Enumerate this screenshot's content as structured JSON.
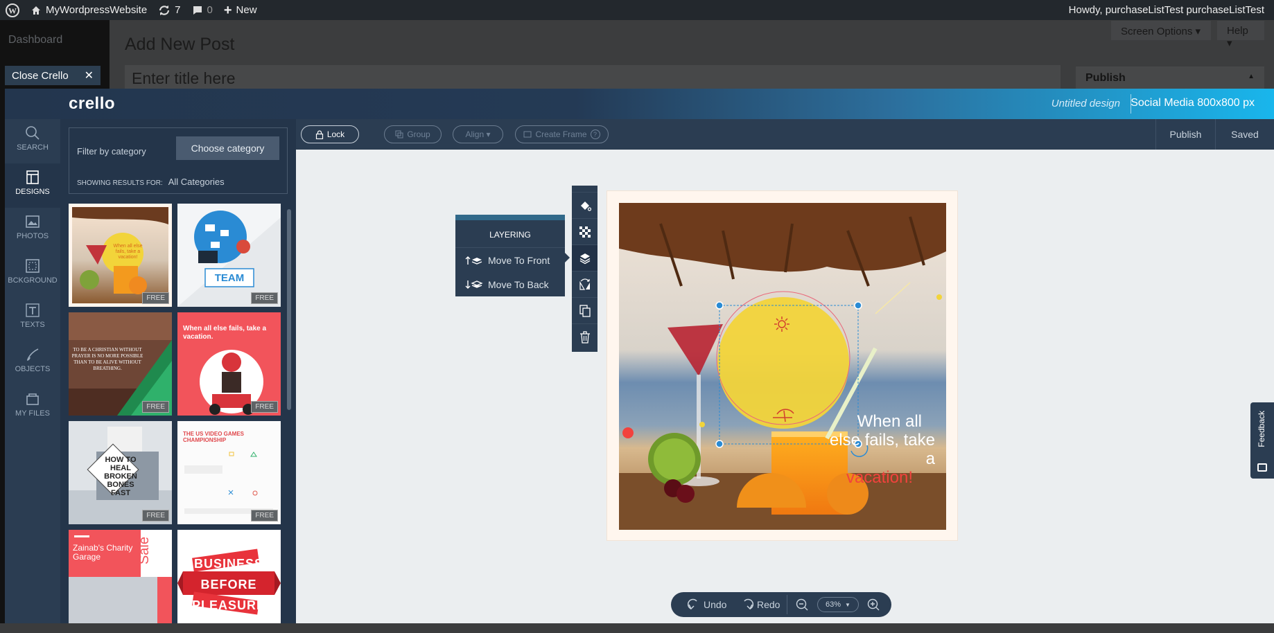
{
  "wp_admin_bar": {
    "site_name": "MyWordpressWebsite",
    "updates_count": "7",
    "comments_count": "0",
    "new_label": "New",
    "greeting": "Howdy, purchaseListTest purchaseListTest"
  },
  "wp_background": {
    "dashboard_label": "Dashboard",
    "page_heading": "Add New Post",
    "title_placeholder": "Enter title here",
    "screen_options": "Screen Options ▾",
    "help": "Help ▾",
    "publish_box": "Publish"
  },
  "close_crello": {
    "label": "Close Crello",
    "icon": "close-icon"
  },
  "crello": {
    "logo": "crello",
    "design_name": "Untitled design",
    "design_size": "Social Media 800x800 px",
    "nav": [
      {
        "label": "SEARCH",
        "icon": "search-icon"
      },
      {
        "label": "DESIGNS",
        "icon": "designs-icon"
      },
      {
        "label": "PHOTOS",
        "icon": "photos-icon"
      },
      {
        "label": "BCKGROUND",
        "icon": "background-icon"
      },
      {
        "label": "TEXTS",
        "icon": "texts-icon"
      },
      {
        "label": "OBJECTS",
        "icon": "objects-icon"
      },
      {
        "label": "MY FILES",
        "icon": "my-files-icon"
      }
    ],
    "filter": {
      "label": "Filter by category",
      "button": "Choose category",
      "showing_label": "SHOWING RESULTS FOR:",
      "showing_value": "All Categories"
    },
    "templates": [
      {
        "badge": "FREE",
        "text": "When all else fails, take a vacation!"
      },
      {
        "badge": "FREE",
        "text": "TEAM"
      },
      {
        "badge": "FREE",
        "text": "TO BE A CHRISTIAN WITHOUT PRAYER IS NO MORE POSSIBLE THAN TO BE ALIVE WITHOUT BREATHING."
      },
      {
        "badge": "FREE",
        "text": "When all else fails, take a vacation."
      },
      {
        "badge": "FREE",
        "text": "HOW TO HEAL BROKEN BONES FAST"
      },
      {
        "badge": "FREE",
        "text": "THE US VIDEO GAMES CHAMPIONSHIP"
      },
      {
        "badge": "",
        "text": "Zainab's Charity Garage",
        "side_text": "Sale"
      },
      {
        "badge": "",
        "text": "BUSINESS BEFORE PLEASURE"
      }
    ],
    "toolbar": {
      "lock": "Lock",
      "group": "Group",
      "align": "Align ▾",
      "create_frame": "Create Frame",
      "publish": "Publish",
      "saved": "Saved"
    },
    "layering": {
      "title": "LAYERING",
      "move_front": "Move To Front",
      "move_back": "Move To Back"
    },
    "vertical_tools": [
      "fill-icon",
      "transparency-icon",
      "layers-icon",
      "flip-icon",
      "duplicate-icon",
      "delete-icon"
    ],
    "canvas": {
      "text_line1": "When all",
      "text_line2": "else fails, take a",
      "text_line3": "vacation!"
    },
    "bottombar": {
      "undo": "Undo",
      "redo": "Redo",
      "zoom": "63%"
    },
    "feedback": "Feedback"
  },
  "colors": {
    "crello_dark": "#2b3d52",
    "accent_blue": "#19b6ec",
    "red_accent": "#f2423d",
    "yellow_circle": "#f2d43a"
  }
}
